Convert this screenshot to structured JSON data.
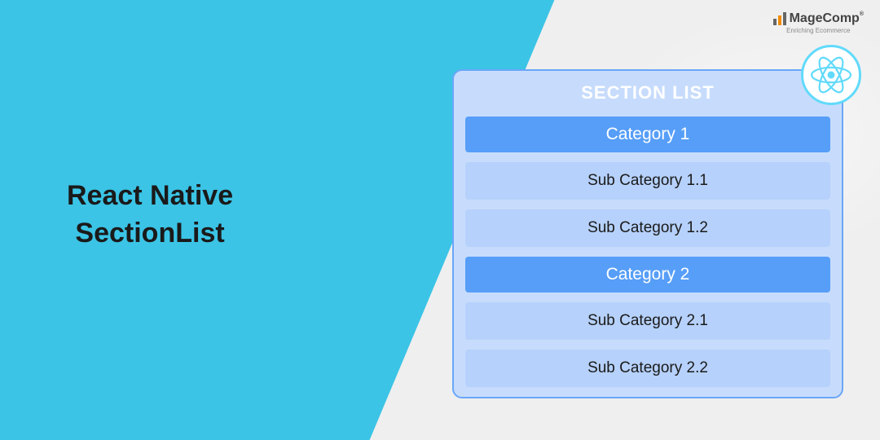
{
  "logo": {
    "name": "MageComp",
    "tagline": "Enriching Ecommerce"
  },
  "title_line1": "React Native",
  "title_line2": "SectionList",
  "card": {
    "header": "SECTION LIST",
    "sections": [
      {
        "title": "Category 1",
        "items": [
          "Sub Category 1.1",
          "Sub Category 1.2"
        ]
      },
      {
        "title": "Category 2",
        "items": [
          "Sub Category 2.1",
          "Sub Category 2.2"
        ]
      }
    ]
  }
}
